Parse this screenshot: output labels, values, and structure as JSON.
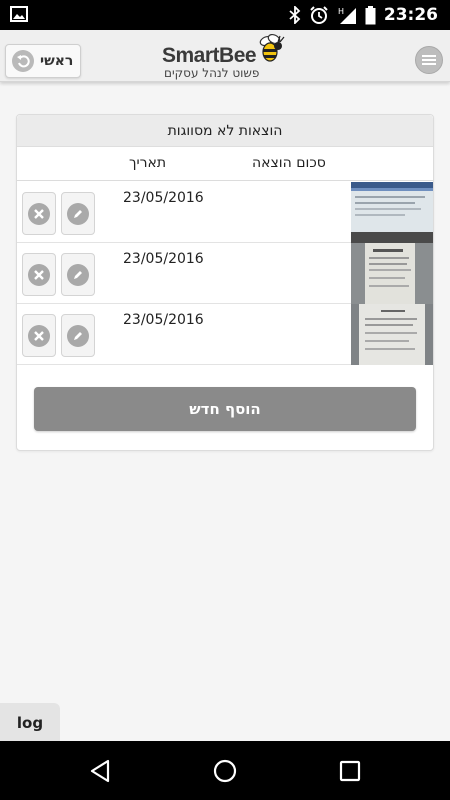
{
  "status_bar": {
    "time": "23:26",
    "icons": [
      "image-icon",
      "bluetooth-icon",
      "alarm-icon",
      "h-signal-icon",
      "battery-icon"
    ],
    "network_letter": "H"
  },
  "header": {
    "home_label": "ראשי",
    "logo_text": "SmartBee",
    "logo_tagline": "פשוט לנהל עסקים",
    "menu_icon": "hamburger-menu-icon"
  },
  "expenses": {
    "title": "הוצאות לא מסווגות",
    "columns": {
      "amount": "סכום הוצאה",
      "date": "תאריך"
    },
    "rows": [
      {
        "date": "23/05/2016",
        "amount": "",
        "thumbnail": "receipt-thumbnail-screen"
      },
      {
        "date": "23/05/2016",
        "amount": "",
        "thumbnail": "receipt-thumbnail-paper"
      },
      {
        "date": "23/05/2016",
        "amount": "",
        "thumbnail": "receipt-thumbnail-document"
      }
    ],
    "add_label": "הוסף חדש"
  },
  "log_label": "log",
  "colors": {
    "header_bg": "#efefef",
    "add_button": "#8a8a8a",
    "icon_gray": "#a9a9a9",
    "bee_yellow": "#f2c40f"
  }
}
